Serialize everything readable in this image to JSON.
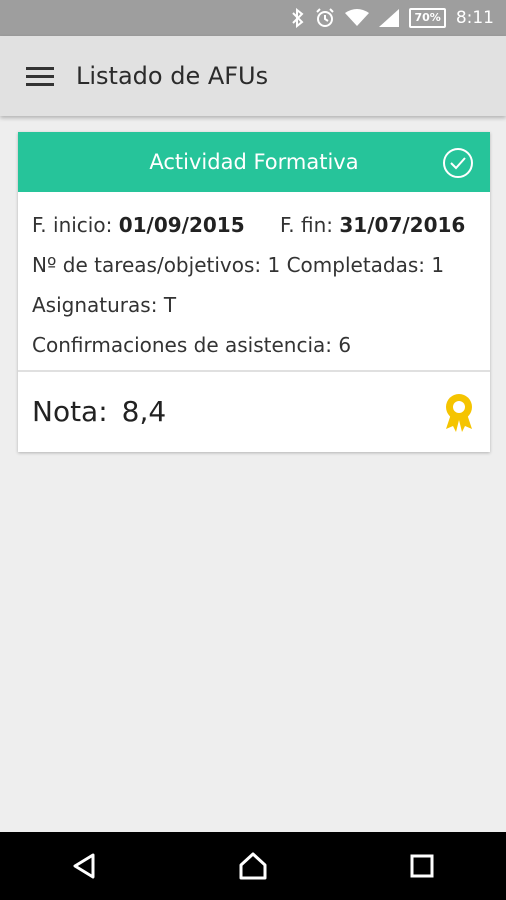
{
  "status_bar": {
    "icons": [
      "bluetooth-icon",
      "alarm-icon",
      "wifi-icon",
      "signal-icon"
    ],
    "battery": "70%",
    "time": "8:11"
  },
  "app_bar": {
    "menu_icon": "menu-icon",
    "title": "Listado de AFUs"
  },
  "card": {
    "header_title": "Actividad Formativa",
    "header_icon": "check-circle-icon",
    "header_color": "#26c49a",
    "start_label": "F. inicio:",
    "start_value": "01/09/2015",
    "end_label": "F. fin:",
    "end_value": "31/07/2016",
    "tasks_label": "Nº de tareas/objetivos:",
    "tasks_value": "1",
    "completed_label": "Completadas:",
    "completed_value": "1",
    "subjects_label": "Asignaturas:",
    "subjects_value": "T",
    "attendance_label": "Confirmaciones de asistencia:",
    "attendance_value": "6",
    "grade_label": "Nota:",
    "grade_value": "8,4",
    "grade_icon": "award-icon",
    "award_color": "#f5c400"
  },
  "nav_bar": {
    "buttons": [
      "back-icon",
      "home-icon",
      "recents-icon"
    ]
  }
}
